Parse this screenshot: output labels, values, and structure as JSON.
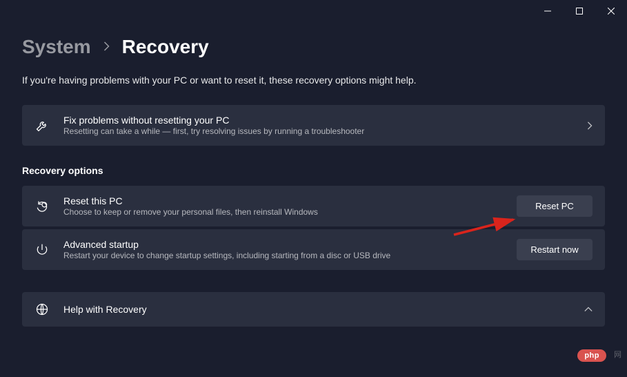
{
  "breadcrumb": {
    "parent": "System",
    "current": "Recovery"
  },
  "intro": "If you're having problems with your PC or want to reset it, these recovery options might help.",
  "fix_card": {
    "title": "Fix problems without resetting your PC",
    "subtitle": "Resetting can take a while — first, try resolving issues by running a troubleshooter"
  },
  "section_title": "Recovery options",
  "reset_card": {
    "title": "Reset this PC",
    "subtitle": "Choose to keep or remove your personal files, then reinstall Windows",
    "button": "Reset PC"
  },
  "advanced_card": {
    "title": "Advanced startup",
    "subtitle": "Restart your device to change startup settings, including starting from a disc or USB drive",
    "button": "Restart now"
  },
  "help_card": {
    "title": "Help with Recovery"
  },
  "watermark": "php",
  "watermark_suffix": "网"
}
